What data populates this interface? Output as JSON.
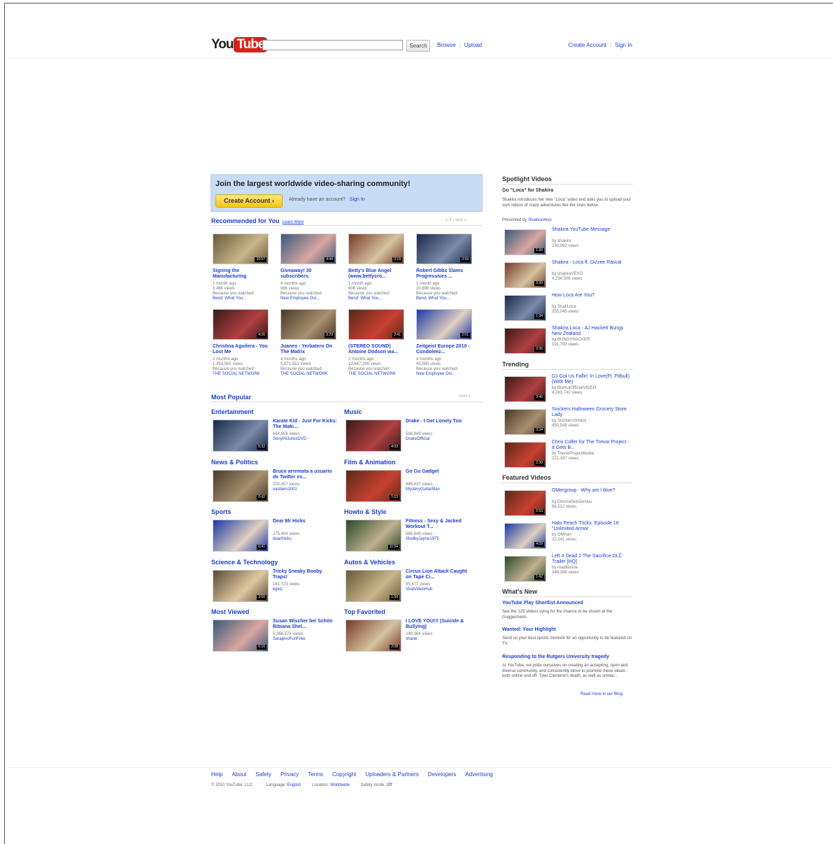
{
  "header": {
    "logo_you": "You",
    "logo_tube": "Tube",
    "search_placeholder": "",
    "search_button": "Search",
    "browse": "Browse",
    "upload": "Upload",
    "create_account": "Create Account",
    "sign_in": "Sign In"
  },
  "banner": {
    "title": "Join the largest worldwide video-sharing community!",
    "button": "Create Account ›",
    "already": "Already have an account?",
    "sign_in": "Sign In"
  },
  "recommended": {
    "title": "Recommended for You",
    "learn_more": "Learn More",
    "pager": "1-8  |  next »",
    "videos": [
      {
        "title": "Signing the Manufacturing",
        "age": "1 month ago",
        "views": "3,466 views",
        "because": "Because you watched",
        "ref": "Bend: What You..."
      },
      {
        "title": "Giveaway! 30 subscribers.",
        "age": "4 months ago",
        "views": "966 views",
        "because": "Because you watched",
        "ref": "New Employee Ovi..."
      },
      {
        "title": "Betty's Blue Angel (www.bettycro...",
        "age": "1 month ago",
        "views": "606 views",
        "because": "Because you watched",
        "ref": "Bend: What You..."
      },
      {
        "title": "Robert Gibbs Slams Progressives ...",
        "age": "1 month ago",
        "views": "20,696 views",
        "because": "Because you watched",
        "ref": "Bend: What You..."
      },
      {
        "title": "Christina Aguilera - You Lost Me",
        "age": "2 months ago",
        "views": "1,451,565 views",
        "because": "Because you watched",
        "ref": "THE SOCIAL NETWORK"
      },
      {
        "title": "Juanes - Yerbatero On The Matrix",
        "age": "4 months ago",
        "views": "5,071,551 views",
        "because": "Because you watched",
        "ref": "THE SOCIAL NETWORK"
      },
      {
        "title": "(STEREO SOUND) Antoine Dodson wa...",
        "age": "2 months ago",
        "views": "13,667,295 views",
        "because": "Because you watched",
        "ref": "THE SOCIAL NETWORK"
      },
      {
        "title": "Zeitgeist Europe 2010 - Condoleez...",
        "age": "4 months ago",
        "views": "45,565 views",
        "because": "Because you watched",
        "ref": "New Employee Ovi..."
      }
    ],
    "durations": [
      "10:57",
      "4:44",
      "3:18",
      "0:59",
      "4:26",
      "3:29",
      "2:41",
      "2:01"
    ]
  },
  "most_popular": {
    "title": "Most Popular",
    "pager": "next »",
    "categories": [
      {
        "name": "Entertainment",
        "video": "Karate Kid - Just For Kicks: The Maki...",
        "views": "664,856 views",
        "user": "SonyPicturesDVD",
        "dur": "5:32"
      },
      {
        "name": "Music",
        "video": "Drake - I Get Lonely Too",
        "views": "586,849 views",
        "user": "DrakeOfficial",
        "dur": "4:03"
      },
      {
        "name": "News & Politics",
        "video": "Bruce arremata a usuario de Twitter es...",
        "views": "203,457 views",
        "user": "vasbaro1001",
        "dur": "0:42"
      },
      {
        "name": "Film & Animation",
        "video": "Go Go Gadget",
        "views": "486,437 views",
        "user": "MysteryGuitarMan",
        "dur": "1:03"
      },
      {
        "name": "Sports",
        "video": "Dear Mr Hicks",
        "views": "275,404 views",
        "user": "deanhicks",
        "dur": "0:41"
      },
      {
        "name": "Howto & Style",
        "video": "Fitness - Sexy & Jacked Workout T...",
        "views": "586,849 views",
        "user": "ShelbyJayne1975",
        "dur": "11:54"
      },
      {
        "name": "Science & Technology",
        "video": "Tricky Sneaky Booby Traps!",
        "views": "161,723 views",
        "user": "kgeiz",
        "dur": "3:50"
      },
      {
        "name": "Autos & Vehicles",
        "video": "Circus Lion Attack Caught on Tape Ci...",
        "views": "95,677 views",
        "user": "ViralVideoHub",
        "dur": "1:58"
      },
      {
        "name": "Most Viewed",
        "video": "Susan Wischer bei Schön Bibiana Shel...",
        "views": "5,366,575 views",
        "user": "SarajevoFunFree",
        "dur": "6:16"
      },
      {
        "name": "Top Favorited",
        "video": "I LOVE YOU!!! (Suicide & Bullying)",
        "views": "249,364 views",
        "user": "shane",
        "dur": "2:08"
      }
    ]
  },
  "spotlight": {
    "title": "Spotlight Videos",
    "subtitle": "Go \"Loca\" for Shakira",
    "desc": "Shakira introduces her new \"Loca\" video and asks you to upload your own videos of crazy adventures like the ones below.",
    "presented": "Presented by",
    "presenter": "ShakiraVevo",
    "videos": [
      {
        "title": "Shakira YouTube Message",
        "user": "by shakira",
        "views": "230,082 views",
        "dur": "1:36"
      },
      {
        "title": "Shakira - Loca ft. Dizzee Rascal",
        "user": "by shakiraVEVO",
        "views": "4,234,506 views",
        "dur": "3:20"
      },
      {
        "title": "How Loca Are You?",
        "user": "by ShakLoca",
        "views": "255,045 views",
        "dur": "1:34"
      },
      {
        "title": "Shakira Loca - AJ Hackett Bungy New Zealand",
        "user": "by BUNGYHACKER",
        "views": "191,750 views",
        "dur": "0:36"
      }
    ]
  },
  "trending": {
    "title": "Trending",
    "videos": [
      {
        "title": "DJ Got Us Fallin' In Love(Ft. Pitbull)(With Me)",
        "user": "by BiancaOfficialVIDEO",
        "views": "4,263,740 views",
        "dur": "3:40"
      },
      {
        "title": "Snickers Halloween Grocery Store Lady",
        "user": "by SnickersSmack",
        "views": "450,549 views",
        "dur": "0:34"
      },
      {
        "title": "Chris Colfer for The Trevor Project - It Gets B...",
        "user": "by TrevorProjectMedia",
        "views": "221,197 views",
        "dur": "2:30"
      }
    ]
  },
  "featured": {
    "title": "Featured Videos",
    "videos": [
      {
        "title": "OMergroup - Why am I blue?",
        "user": "by ElectraSkinGenius",
        "views": "68,512 views",
        "dur": "0:53"
      },
      {
        "title": "Halo Reach Tricks: Episode 16 \"Unlimited Armor",
        "user": "by OMhan",
        "views": "22,241 views",
        "dur": "4:09"
      },
      {
        "title": "Left 4 Dead 2 The Sacrifice DLC Trailer [HQ]",
        "user": "by madilestne",
        "views": "348,398 views",
        "dur": "1:42"
      }
    ]
  },
  "whats_new": {
    "title": "What's New",
    "items": [
      {
        "title": "YouTube Play Shortlist Announced",
        "text": "See the 125 videos vying for the chance to be shown at the Guggenheim."
      },
      {
        "title": "Wanted: Your Highlight",
        "text": "Send us your best sports moment for an opportunity to be featured on TV."
      },
      {
        "title": "Responding to the Rutgers University tragedy",
        "text": "At YouTube, we pride ourselves on creating an accepting, open and diverse community, and consistently strive to promote these ideals - both online and off. Tyler Clementi's death, as well as similar..."
      }
    ],
    "read_more": "Read more in our Blog"
  },
  "footer": {
    "links": [
      "Help",
      "About",
      "Safety",
      "Privacy",
      "Terms",
      "Copyright",
      "Uploaders & Partners",
      "Developers",
      "Advertising"
    ],
    "copyright": "© 2010 YouTube, LLC",
    "language_label": "Language:",
    "language": "English",
    "location_label": "Location:",
    "location": "Worldwide",
    "safety_label": "Safety mode:",
    "safety": "Off"
  }
}
